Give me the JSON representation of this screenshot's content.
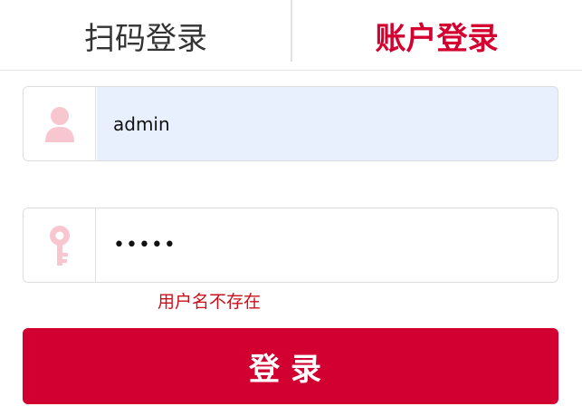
{
  "tabs": {
    "qr_label": "扫码登录",
    "account_label": "账户登录",
    "active": "account"
  },
  "username_field": {
    "value": "admin",
    "icon": "user-icon"
  },
  "password_field": {
    "value": "•••••",
    "icon": "key-icon"
  },
  "error": {
    "message": "用户名不存在"
  },
  "login_button": {
    "label": "登录"
  },
  "colors": {
    "accent": "#d20030",
    "icon_pink": "#f7c6cf",
    "autofill_bg": "#e8f0fe",
    "error_text": "#c8101a"
  }
}
